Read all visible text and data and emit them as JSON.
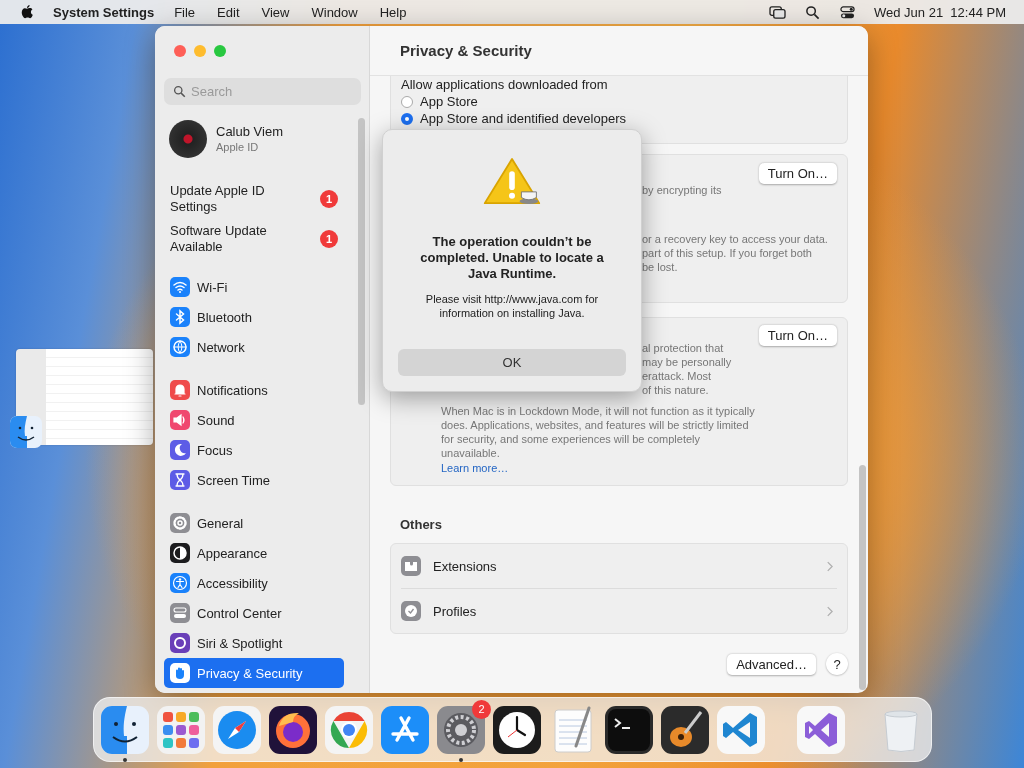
{
  "menu_bar": {
    "app": "System Settings",
    "menus": [
      "File",
      "Edit",
      "View",
      "Window",
      "Help"
    ],
    "clock": "Wed Jun 21  12:44 PM"
  },
  "window": {
    "title": "Privacy & Security"
  },
  "sidebar": {
    "search": {
      "placeholder": "Search"
    },
    "account": {
      "name": "Calub Viem",
      "subtitle": "Apple ID"
    },
    "alerts": [
      {
        "label": "Update Apple ID Settings",
        "badge": "1"
      },
      {
        "label": "Software Update Available",
        "badge": "1"
      }
    ],
    "groups": [
      {
        "items": [
          {
            "kind": "wifi",
            "label": "Wi-Fi",
            "selected": false
          },
          {
            "kind": "bluetooth",
            "label": "Bluetooth",
            "selected": false
          },
          {
            "kind": "network",
            "label": "Network",
            "selected": false
          }
        ]
      },
      {
        "items": [
          {
            "kind": "notifications",
            "label": "Notifications",
            "selected": false
          },
          {
            "kind": "sound",
            "label": "Sound",
            "selected": false
          },
          {
            "kind": "focus",
            "label": "Focus",
            "selected": false
          },
          {
            "kind": "screentime",
            "label": "Screen Time",
            "selected": false
          }
        ]
      },
      {
        "items": [
          {
            "kind": "general",
            "label": "General",
            "selected": false
          },
          {
            "kind": "appearance",
            "label": "Appearance",
            "selected": false
          },
          {
            "kind": "accessibility",
            "label": "Accessibility",
            "selected": false
          },
          {
            "kind": "controlcenter",
            "label": "Control Center",
            "selected": false
          },
          {
            "kind": "siri",
            "label": "Siri & Spotlight",
            "selected": false
          },
          {
            "kind": "privacy",
            "label": "Privacy & Security",
            "selected": true
          }
        ]
      }
    ]
  },
  "security": {
    "allow_label": "Allow applications downloaded from",
    "options": [
      {
        "label": "App Store",
        "selected": false
      },
      {
        "label": "App Store and identified developers",
        "selected": true
      }
    ]
  },
  "filevault": {
    "button": "Turn On…",
    "fragments": [
      {
        "lines": [
          "by encrypting its"
        ]
      },
      {
        "lines": [
          "or a recovery key to access your data.",
          "part of this setup. If you forget both",
          "be lost."
        ]
      }
    ]
  },
  "lockdown": {
    "button": "Turn On…",
    "fragments": [
      {
        "lines": [
          "al protection that",
          "may be personally",
          "erattack. Most",
          "of this nature."
        ]
      }
    ],
    "paragraph": "When Mac is in Lockdown Mode, it will not function as it typically does. Applications, websites, and features will be strictly limited for security, and some experiences will be completely unavailable.",
    "link": "Learn more…"
  },
  "others": {
    "title": "Others",
    "items": [
      {
        "kind": "extensions",
        "label": "Extensions"
      },
      {
        "kind": "profiles",
        "label": "Profiles"
      }
    ]
  },
  "footer": {
    "advanced": "Advanced…",
    "help": "?"
  },
  "dialog": {
    "title": "The operation couldn’t be completed. Unable to locate a Java Runtime.",
    "message": "Please visit http://www.java.com for information on installing Java.",
    "button": "OK"
  },
  "dock": {
    "items": [
      {
        "kind": "finder",
        "running": true
      },
      {
        "kind": "launchpad",
        "running": false
      },
      {
        "kind": "safari",
        "running": false
      },
      {
        "kind": "firefox",
        "running": false
      },
      {
        "kind": "chrome",
        "running": false
      },
      {
        "kind": "appstore",
        "running": false
      },
      {
        "kind": "settings",
        "running": true,
        "badge": "2"
      },
      {
        "kind": "clock",
        "running": false
      },
      {
        "kind": "textedit",
        "running": false
      },
      {
        "kind": "terminal",
        "running": false
      },
      {
        "kind": "guitar",
        "running": false
      },
      {
        "kind": "vscode",
        "running": false
      },
      {
        "kind": "separator"
      },
      {
        "kind": "vstudio",
        "running": false
      },
      {
        "kind": "separator"
      },
      {
        "kind": "trash",
        "running": false
      }
    ]
  }
}
